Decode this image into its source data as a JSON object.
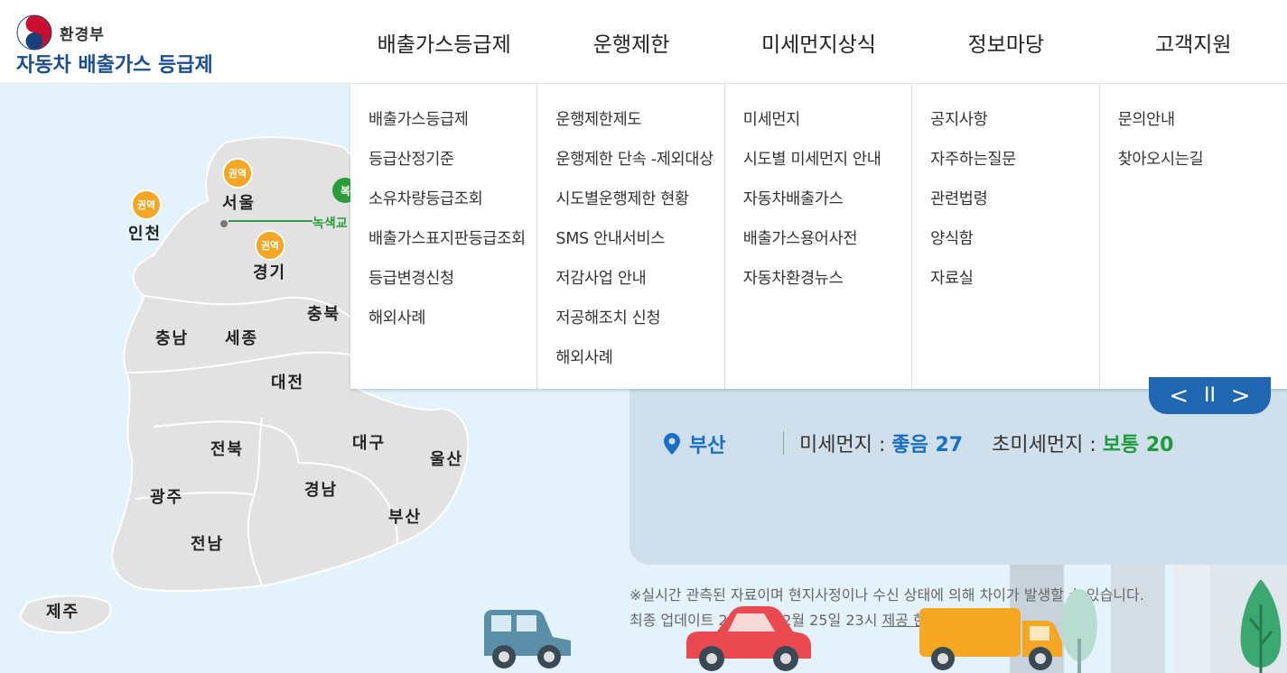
{
  "logo": {
    "ministry": "환경부",
    "title": "자동차 배출가스 등급제"
  },
  "gnb": [
    {
      "label": "배출가스등급제",
      "items": [
        "배출가스등급제",
        "등급산정기준",
        "소유차량등급조회",
        "배출가스표지판등급조회",
        "등급변경신청",
        "해외사례"
      ]
    },
    {
      "label": "운행제한",
      "items": [
        "운행제한제도",
        "운행제한 단속 -제외대상",
        "시도별운행제한 현황",
        "SMS 안내서비스",
        "저감사업 안내",
        "저공해조치 신청",
        "해외사례"
      ]
    },
    {
      "label": "미세먼지상식",
      "items": [
        "미세먼지",
        "시도별 미세먼지 안내",
        "자동차배출가스",
        "배출가스용어사전",
        "자동차환경뉴스"
      ]
    },
    {
      "label": "정보마당",
      "items": [
        "공지사항",
        "자주하는질문",
        "관련법령",
        "양식함",
        "자료실"
      ]
    },
    {
      "label": "고객지원",
      "items": [
        "문의안내",
        "찾아오시는길"
      ]
    }
  ],
  "map": {
    "badge_text": "권역",
    "green_line_text": "녹색교",
    "regions": {
      "seoul": "서울",
      "incheon": "인천",
      "gyeonggi": "경기",
      "chungbuk": "충북",
      "chungnam": "충남",
      "sejong": "세종",
      "daejeon": "대전",
      "jeonbuk": "전북",
      "daegu": "대구",
      "ulsan": "울산",
      "gwangju": "광주",
      "gyeongnam": "경남",
      "busan": "부산",
      "jeonnam": "전남",
      "jeju": "제주"
    }
  },
  "info": {
    "city": "부산",
    "pm10_label": "미세먼지 : ",
    "pm10_value": "좋음 27",
    "pm25_label": "초미세먼지 : ",
    "pm25_value": "보통 20"
  },
  "controls": {
    "prev": "<",
    "pause": "II",
    "next": ">"
  },
  "note": {
    "line1": "※실시간 관측된 자료이며 현지사정이나 수신 상태에 의해 차이가 발생할 수 있습니다.",
    "line2_prefix": "최종 업데이트 2021년 02월 25일 23시 ",
    "source": "제공 한국환경공단"
  },
  "colors": {
    "brand_blue": "#1a4e8c",
    "accent_blue": "#2166b0",
    "good": "#1a6fc4",
    "normal": "#1f9a3a",
    "badge": "#f5a623"
  }
}
